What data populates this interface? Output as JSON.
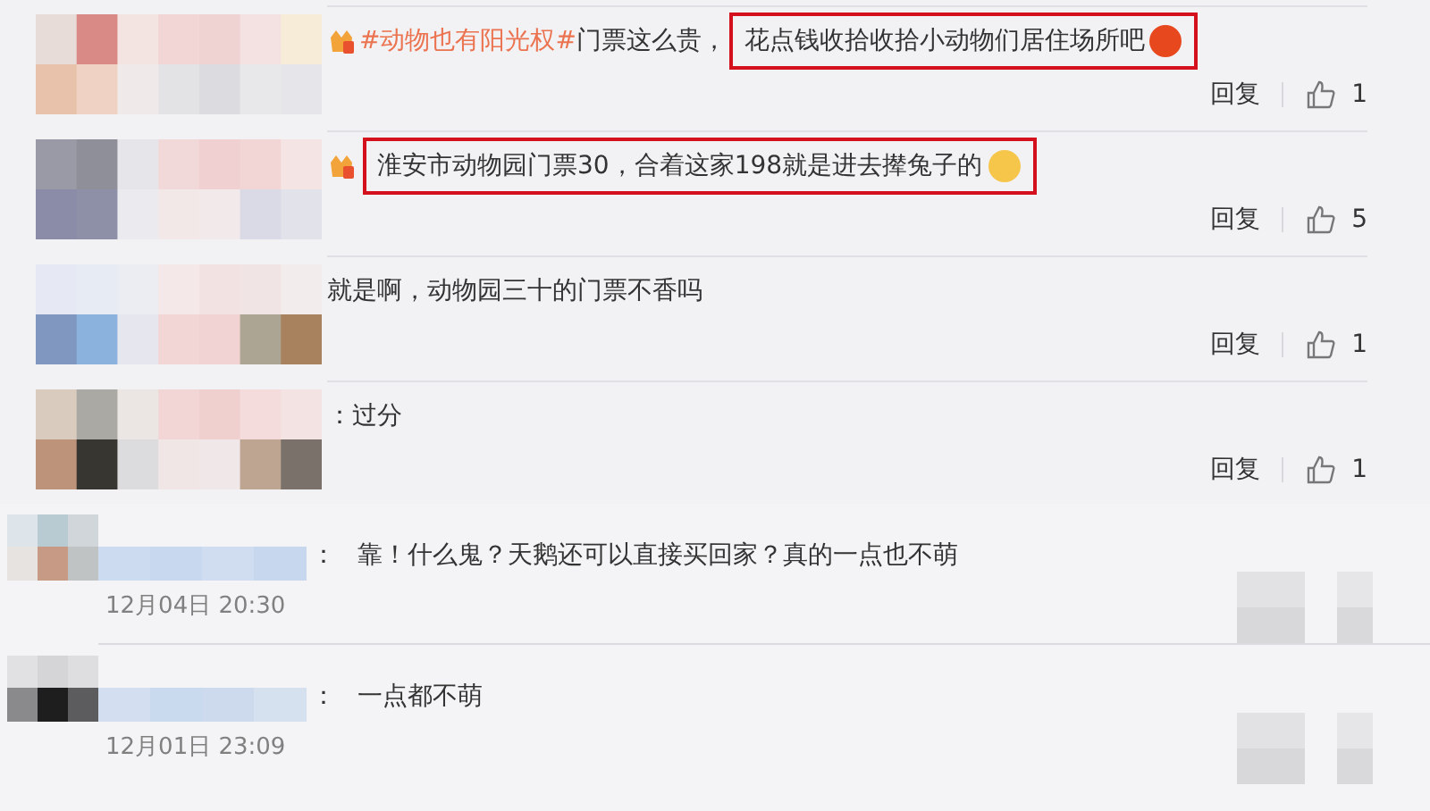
{
  "replies": [
    {
      "badge": true,
      "segments": [
        {
          "kind": "hashtag",
          "text": "#动物也有阳光权#",
          "highlighted": false
        },
        {
          "kind": "text",
          "text": "门票这么贵，",
          "highlighted": false
        },
        {
          "kind": "text",
          "text": "花点钱收拾收拾小动物们居住场所吧",
          "highlighted": true
        },
        {
          "kind": "emoji",
          "highlighted": true
        }
      ],
      "reply_label": "回复",
      "likes": "1"
    },
    {
      "badge": true,
      "segments": [
        {
          "kind": "text",
          "text": "淮安市动物园门票30，合着这家198就是进去撵兔子的",
          "highlighted": true
        },
        {
          "kind": "emoji",
          "highlighted": true
        }
      ],
      "reply_label": "回复",
      "likes": "5"
    },
    {
      "badge": false,
      "segments": [
        {
          "kind": "text",
          "text": "就是啊，动物园三十的门票不香吗",
          "highlighted": false
        }
      ],
      "reply_label": "回复",
      "likes": "1"
    },
    {
      "badge": false,
      "segments": [
        {
          "kind": "text",
          "text": "：过分",
          "highlighted": false
        }
      ],
      "reply_label": "回复",
      "likes": "1"
    }
  ],
  "comments": [
    {
      "separator": "：",
      "text": "靠！什么鬼？天鹅还可以直接买回家？真的一点也不萌",
      "time": "12月04日 20:30"
    },
    {
      "separator": "：",
      "text": "一点都不萌",
      "time": "12月01日 23:09"
    }
  ]
}
